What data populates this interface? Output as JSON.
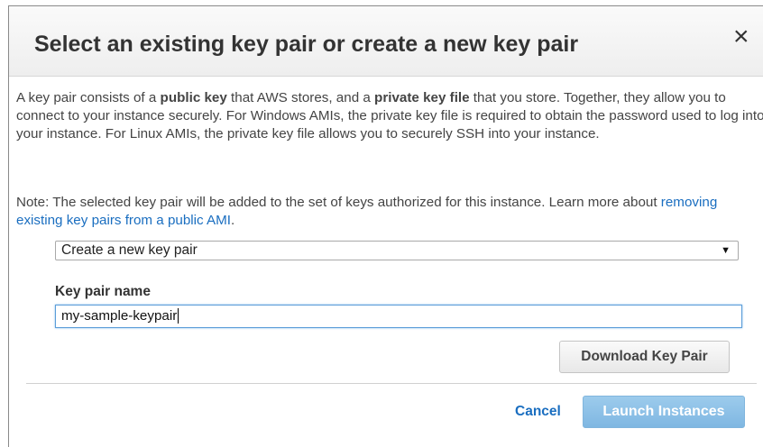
{
  "dialog": {
    "title": "Select an existing key pair or create a new key pair",
    "close_symbol": "×",
    "intro": {
      "p1": "A key pair consists of a ",
      "b1": "public key",
      "p2": " that AWS stores, and a ",
      "b2": "private key file",
      "p3": " that you store. Together, they allow you to connect to your instance securely. For Windows AMIs, the private key file is required to obtain the password used to log into your instance. For Linux AMIs, the private key file allows you to securely SSH into your instance."
    },
    "note": {
      "text": "Note: The selected key pair will be added to the set of keys authorized for this instance. Learn more about ",
      "link": "removing existing key pairs from a public AMI",
      "end": "."
    },
    "key_pair_select": {
      "selected": "Create a new key pair",
      "arrow": "▼"
    },
    "key_pair_name": {
      "label": "Key pair name",
      "value": "my-sample-keypair"
    },
    "download_label": "Download Key Pair",
    "cancel_label": "Cancel",
    "launch_label": "Launch Instances",
    "icons": {
      "close": "close-icon",
      "dropdown": "chevron-down-icon"
    },
    "colors": {
      "link": "#1a6ec0",
      "launch_button_disabled": "#8cc1e7"
    }
  }
}
